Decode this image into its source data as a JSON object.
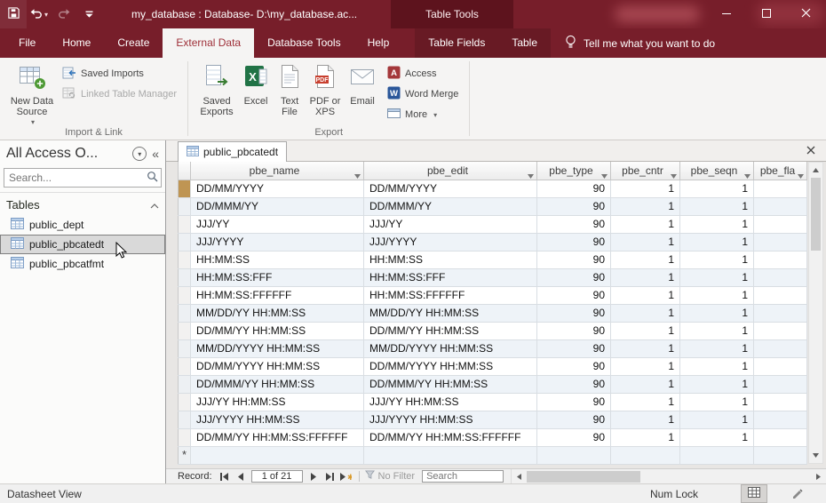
{
  "window": {
    "title": "my_database : Database- D:\\my_database.ac...",
    "contextual_group": "Table Tools"
  },
  "ribbon": {
    "tabs": [
      "File",
      "Home",
      "Create",
      "External Data",
      "Database Tools",
      "Help"
    ],
    "active_tab": "External Data",
    "contextual_tabs": [
      "Table Fields",
      "Table"
    ],
    "tell_me": "Tell me what you want to do",
    "groups": [
      {
        "label": "Import & Link",
        "buttons": {
          "new_data_source": "New Data Source",
          "saved_imports": "Saved Imports",
          "linked_table_manager": "Linked Table Manager"
        }
      },
      {
        "label": "Export",
        "buttons": {
          "saved_exports": "Saved Exports",
          "excel": "Excel",
          "text_file": "Text File",
          "pdf_or_xps": "PDF or XPS",
          "email": "Email",
          "access": "Access",
          "word_merge": "Word Merge",
          "more": "More"
        }
      }
    ]
  },
  "nav_pane": {
    "title": "All Access O...",
    "search_placeholder": "Search...",
    "group_label": "Tables",
    "items": [
      "public_dept",
      "public_pbcatedt",
      "public_pbcatfmt"
    ],
    "selected_item": "public_pbcatedt"
  },
  "document": {
    "tab_label": "public_pbcatedt",
    "table": {
      "columns": [
        "pbe_name",
        "pbe_edit",
        "pbe_type",
        "pbe_cntr",
        "pbe_seqn",
        "pbe_fla"
      ],
      "new_record_marker": "*",
      "rows": [
        {
          "name": "DD/MM/YYYY",
          "edit": "DD/MM/YYYY",
          "type": "90",
          "cntr": "1",
          "seqn": "1"
        },
        {
          "name": "DD/MMM/YY",
          "edit": "DD/MMM/YY",
          "type": "90",
          "cntr": "1",
          "seqn": "1"
        },
        {
          "name": "JJJ/YY",
          "edit": "JJJ/YY",
          "type": "90",
          "cntr": "1",
          "seqn": "1"
        },
        {
          "name": "JJJ/YYYY",
          "edit": "JJJ/YYYY",
          "type": "90",
          "cntr": "1",
          "seqn": "1"
        },
        {
          "name": "HH:MM:SS",
          "edit": "HH:MM:SS",
          "type": "90",
          "cntr": "1",
          "seqn": "1"
        },
        {
          "name": "HH:MM:SS:FFF",
          "edit": "HH:MM:SS:FFF",
          "type": "90",
          "cntr": "1",
          "seqn": "1"
        },
        {
          "name": "HH:MM:SS:FFFFFF",
          "edit": "HH:MM:SS:FFFFFF",
          "type": "90",
          "cntr": "1",
          "seqn": "1"
        },
        {
          "name": "MM/DD/YY HH:MM:SS",
          "edit": "MM/DD/YY HH:MM:SS",
          "type": "90",
          "cntr": "1",
          "seqn": "1"
        },
        {
          "name": "DD/MM/YY HH:MM:SS",
          "edit": "DD/MM/YY HH:MM:SS",
          "type": "90",
          "cntr": "1",
          "seqn": "1"
        },
        {
          "name": "MM/DD/YYYY HH:MM:SS",
          "edit": "MM/DD/YYYY HH:MM:SS",
          "type": "90",
          "cntr": "1",
          "seqn": "1"
        },
        {
          "name": "DD/MM/YYYY HH:MM:SS",
          "edit": "DD/MM/YYYY HH:MM:SS",
          "type": "90",
          "cntr": "1",
          "seqn": "1"
        },
        {
          "name": "DD/MMM/YY HH:MM:SS",
          "edit": "DD/MMM/YY HH:MM:SS",
          "type": "90",
          "cntr": "1",
          "seqn": "1"
        },
        {
          "name": "JJJ/YY HH:MM:SS",
          "edit": "JJJ/YY HH:MM:SS",
          "type": "90",
          "cntr": "1",
          "seqn": "1"
        },
        {
          "name": "JJJ/YYYY HH:MM:SS",
          "edit": "JJJ/YYYY HH:MM:SS",
          "type": "90",
          "cntr": "1",
          "seqn": "1"
        },
        {
          "name": "DD/MM/YY HH:MM:SS:FFFFFF",
          "edit": "DD/MM/YY HH:MM:SS:FFFFFF",
          "type": "90",
          "cntr": "1",
          "seqn": "1"
        }
      ]
    },
    "record_nav": {
      "label": "Record:",
      "position": "1 of 21",
      "filter_label": "No Filter",
      "search_placeholder": "Search"
    }
  },
  "status_bar": {
    "left": "Datasheet View",
    "num_lock": "Num Lock"
  },
  "colors": {
    "title_bar": "#771e2a",
    "contextual_header": "#5d131d",
    "accent_red": "#a4373a",
    "excel_green": "#217346",
    "word_blue": "#2b579a",
    "row_alt": "#eef3f8",
    "current_record_selector": "#bf9553"
  },
  "icons": {
    "qat": [
      "save-icon",
      "undo-icon",
      "redo-icon",
      "customize-qat-icon"
    ],
    "tell_me": "lightbulb-icon",
    "window_controls": [
      "minimize-icon",
      "maximize-icon",
      "close-icon"
    ],
    "nav": [
      "dropdown-circle-icon",
      "shutter-collapse-icon",
      "search-icon",
      "chevron-up-icon",
      "table-icon"
    ],
    "record_nav": [
      "first-record-icon",
      "previous-record-icon",
      "next-record-icon",
      "last-record-icon",
      "new-record-icon",
      "funnel-icon"
    ],
    "status": [
      "datasheet-view-icon",
      "design-view-icon"
    ]
  }
}
